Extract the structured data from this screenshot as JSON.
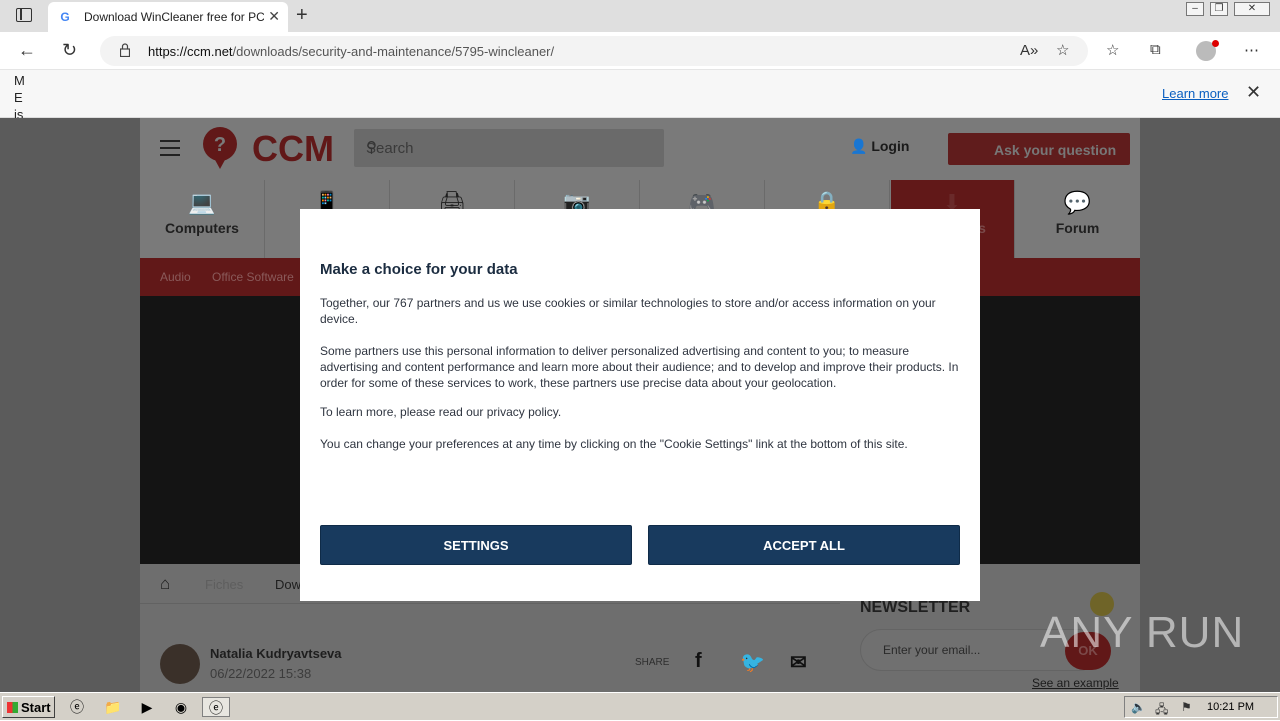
{
  "browser": {
    "tab_title": "Download WinCleaner free for PC",
    "tab_close": "✕",
    "new_tab": "+",
    "url_domain": "https://ccm.net",
    "url_path": "/downloads/security-and-maintenance/5795-wincleaner/",
    "window_controls": [
      "–",
      "❐",
      "✕"
    ]
  },
  "infobar": {
    "text_fragment": "M E is",
    "learn_more": "Learn more",
    "close": "✕"
  },
  "site": {
    "logo_text": "CCM",
    "search_placeholder": "Search",
    "login_label": "Login",
    "ask_label": "Ask your question",
    "categories": [
      {
        "label": "Computers",
        "icon": "laptop-icon"
      },
      {
        "label": "",
        "icon": "phone-icon"
      },
      {
        "label": "",
        "icon": "devices-icon"
      },
      {
        "label": "",
        "icon": "camera-icon"
      },
      {
        "label": "",
        "icon": "gamepad-icon"
      },
      {
        "label": "",
        "icon": "lock-icon"
      },
      {
        "label": "s",
        "icon": "download-icon"
      },
      {
        "label": "Forum",
        "icon": "chat-icon"
      }
    ],
    "subnav": [
      "Audio",
      "Office Software"
    ],
    "breadcrumb": [
      "Fiches",
      "Dow"
    ],
    "author_name": "Natalia Kudryavtseva",
    "author_date": "06/22/2022 15:38",
    "share_label": "SHARE",
    "newsletter_title": "NEWSLETTER",
    "newsletter_placeholder": "Enter your email...",
    "newsletter_ok": "OK",
    "see_example": "See an example"
  },
  "modal": {
    "title": "Make a choice for your data",
    "p1": "Together, our 767 partners and us we use cookies or similar technologies to store and/or access information on your device.",
    "p2": "Some partners use this personal information to deliver personalized advertising and content to you; to measure advertising and content performance and learn more about their audience; and to develop and improve their products. In order for some of these services to work, these partners use precise data about your geolocation.",
    "p3": "To learn more, please read our privacy policy.",
    "p4": "You can change your preferences at any time by clicking on the \"Cookie Settings\" link at the bottom of this site.",
    "settings_label": "SETTINGS",
    "accept_label": "ACCEPT ALL"
  },
  "watermark": "ANY RUN",
  "taskbar": {
    "start_label": "Start",
    "clock": "10:21 PM"
  }
}
